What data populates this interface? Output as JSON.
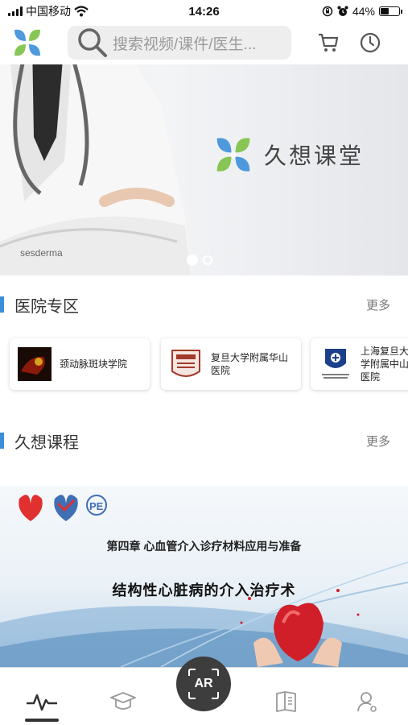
{
  "status_bar": {
    "carrier": "中国移动",
    "time": "14:26",
    "battery_text": "44%",
    "battery_level": 0.44,
    "icons": [
      "signal-icon",
      "wifi-icon",
      "rotation-lock-icon",
      "alarm-icon",
      "battery-icon"
    ]
  },
  "header": {
    "search_placeholder": "搜索视频/课件/医生...",
    "icons": [
      "logo-icon",
      "search-icon",
      "cart-icon",
      "clock-icon"
    ]
  },
  "banner": {
    "brand_title": "久想课堂",
    "coat_text": "sesderma",
    "slide_count": 2,
    "active_slide": 0
  },
  "hospital_section": {
    "title": "医院专区",
    "more_label": "更多",
    "cards": [
      {
        "label": "颈动脉斑块学院"
      },
      {
        "label": "复旦大学附属华山医院"
      },
      {
        "label": "上海复旦大学附属中山医院"
      }
    ]
  },
  "course_section": {
    "title": "久想课程",
    "more_label": "更多",
    "course": {
      "chapter": "第四章 心血管介入诊疗材料应用与准备",
      "title": "结构性心脏病的介入治疗术",
      "logo_text": "PE"
    }
  },
  "bottom_nav": {
    "ar_label": "AR",
    "items": [
      "pulse-icon",
      "graduation-cap-icon",
      "book-icon",
      "profile-icon"
    ],
    "active_index": 0
  },
  "colors": {
    "accent": "#3b8fd9",
    "logo_blue": "#3b8fd9",
    "logo_green": "#7bc043",
    "ar_button": "#3d3d3d"
  }
}
